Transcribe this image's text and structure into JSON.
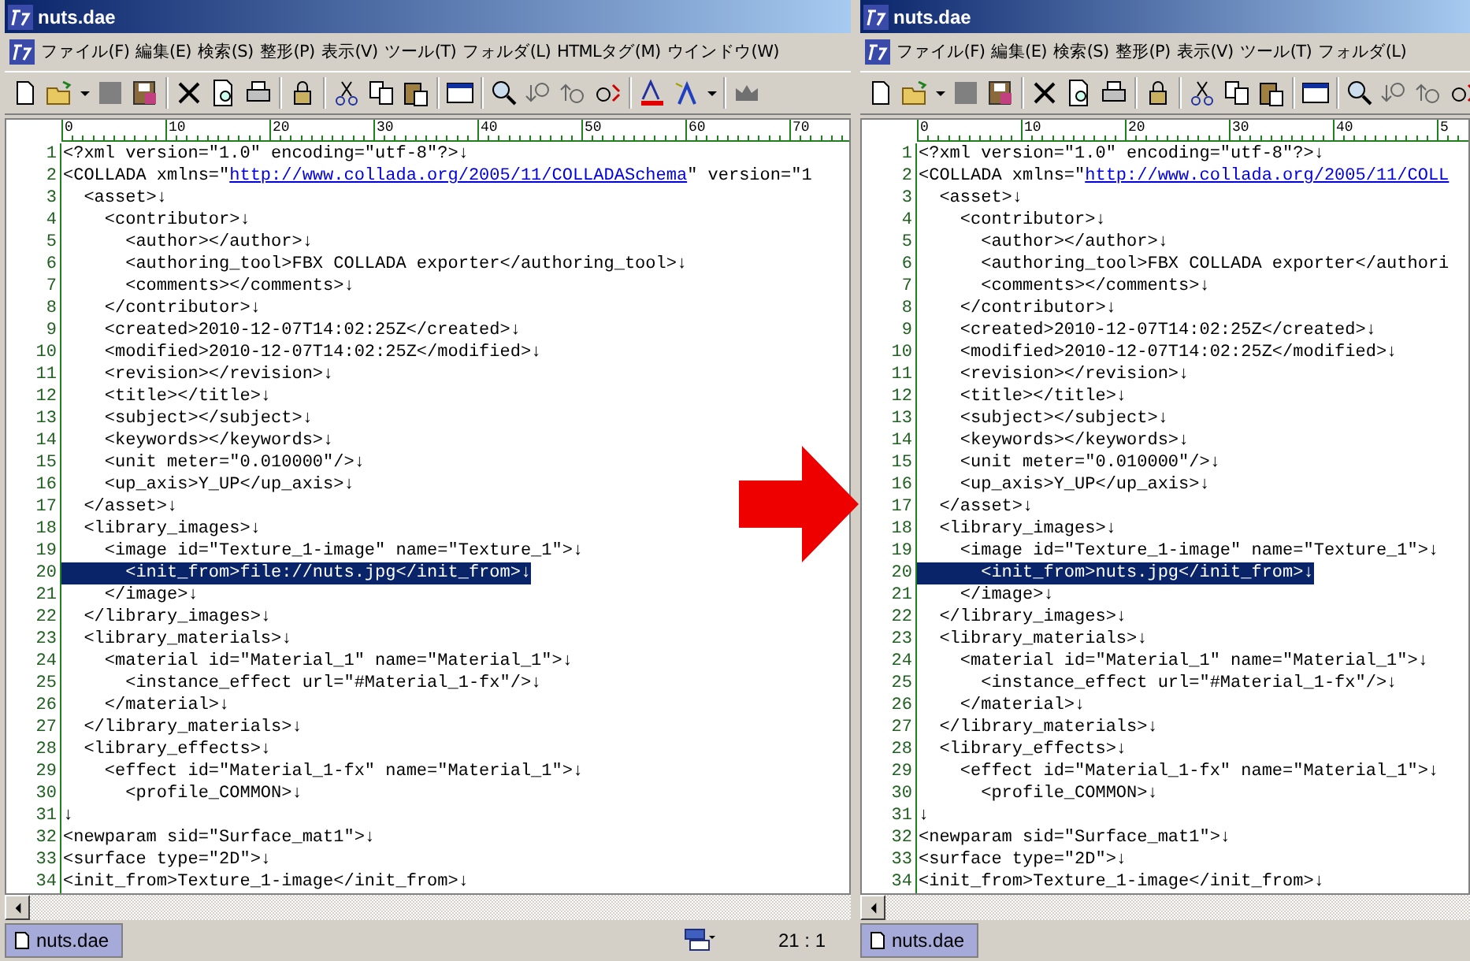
{
  "panes": [
    {
      "title": "nuts.dae",
      "menu": [
        "ファイル(F)",
        "編集(E)",
        "検索(S)",
        "整形(P)",
        "表示(V)",
        "ツール(T)",
        "フォルダ(L)",
        "HTMLタグ(M)",
        "ウインドウ(W)"
      ],
      "ruler": [
        "0",
        "10",
        "20",
        "30",
        "40",
        "50",
        "60",
        "70"
      ],
      "lines": [
        {
          "number": "1",
          "text": "<?xml version=\"1.0\" encoding=\"utf-8\"?>↓",
          "selected": false
        },
        {
          "number": "2",
          "text": "<COLLADA xmlns=\"",
          "link": "http://www.collada.org/2005/11/COLLADASchema",
          "after": "\" version=\"1",
          "selected": false
        },
        {
          "number": "3",
          "text": "  <asset>↓",
          "selected": false
        },
        {
          "number": "4",
          "text": "    <contributor>↓",
          "selected": false
        },
        {
          "number": "5",
          "text": "      <author></author>↓",
          "selected": false
        },
        {
          "number": "6",
          "text": "      <authoring_tool>FBX COLLADA exporter</authoring_tool>↓",
          "selected": false
        },
        {
          "number": "7",
          "text": "      <comments></comments>↓",
          "selected": false
        },
        {
          "number": "8",
          "text": "    </contributor>↓",
          "selected": false
        },
        {
          "number": "9",
          "text": "    <created>2010-12-07T14:02:25Z</created>↓",
          "selected": false
        },
        {
          "number": "10",
          "text": "    <modified>2010-12-07T14:02:25Z</modified>↓",
          "selected": false
        },
        {
          "number": "11",
          "text": "    <revision></revision>↓",
          "selected": false
        },
        {
          "number": "12",
          "text": "    <title></title>↓",
          "selected": false
        },
        {
          "number": "13",
          "text": "    <subject></subject>↓",
          "selected": false
        },
        {
          "number": "14",
          "text": "    <keywords></keywords>↓",
          "selected": false
        },
        {
          "number": "15",
          "text": "    <unit meter=\"0.010000\"/>↓",
          "selected": false
        },
        {
          "number": "16",
          "text": "    <up_axis>Y_UP</up_axis>↓",
          "selected": false
        },
        {
          "number": "17",
          "text": "  </asset>↓",
          "selected": false
        },
        {
          "number": "18",
          "text": "  <library_images>↓",
          "selected": false
        },
        {
          "number": "19",
          "text": "    <image id=\"Texture_1-image\" name=\"Texture_1\">↓",
          "selected": false
        },
        {
          "number": "20",
          "text": "      <init_from>file://nuts.jpg</init_from>↓",
          "selected": true
        },
        {
          "number": "21",
          "text": "    </image>↓",
          "selected": false
        },
        {
          "number": "22",
          "text": "  </library_images>↓",
          "selected": false
        },
        {
          "number": "23",
          "text": "  <library_materials>↓",
          "selected": false
        },
        {
          "number": "24",
          "text": "    <material id=\"Material_1\" name=\"Material_1\">↓",
          "selected": false
        },
        {
          "number": "25",
          "text": "      <instance_effect url=\"#Material_1-fx\"/>↓",
          "selected": false
        },
        {
          "number": "26",
          "text": "    </material>↓",
          "selected": false
        },
        {
          "number": "27",
          "text": "  </library_materials>↓",
          "selected": false
        },
        {
          "number": "28",
          "text": "  <library_effects>↓",
          "selected": false
        },
        {
          "number": "29",
          "text": "    <effect id=\"Material_1-fx\" name=\"Material_1\">↓",
          "selected": false
        },
        {
          "number": "30",
          "text": "      <profile_COMMON>↓",
          "selected": false
        },
        {
          "number": "31",
          "text": "↓",
          "selected": false
        },
        {
          "number": "32",
          "text": "<newparam sid=\"Surface_mat1\">↓",
          "selected": false
        },
        {
          "number": "33",
          "text": "<surface type=\"2D\">↓",
          "selected": false
        },
        {
          "number": "34",
          "text": "<init_from>Texture_1-image</init_from>↓",
          "selected": false
        }
      ],
      "status": {
        "tab": "nuts.dae",
        "position": "21 : 1"
      }
    },
    {
      "title": "nuts.dae",
      "menu": [
        "ファイル(F)",
        "編集(E)",
        "検索(S)",
        "整形(P)",
        "表示(V)",
        "ツール(T)",
        "フォルダ(L)"
      ],
      "ruler": [
        "0",
        "10",
        "20",
        "30",
        "40",
        "5"
      ],
      "lines": [
        {
          "number": "1",
          "text": "<?xml version=\"1.0\" encoding=\"utf-8\"?>↓",
          "selected": false
        },
        {
          "number": "2",
          "text": "<COLLADA xmlns=\"",
          "link": "http://www.collada.org/2005/11/COLL",
          "selected": false
        },
        {
          "number": "3",
          "text": "  <asset>↓",
          "selected": false
        },
        {
          "number": "4",
          "text": "    <contributor>↓",
          "selected": false
        },
        {
          "number": "5",
          "text": "      <author></author>↓",
          "selected": false
        },
        {
          "number": "6",
          "text": "      <authoring_tool>FBX COLLADA exporter</authori",
          "selected": false
        },
        {
          "number": "7",
          "text": "      <comments></comments>↓",
          "selected": false
        },
        {
          "number": "8",
          "text": "    </contributor>↓",
          "selected": false
        },
        {
          "number": "9",
          "text": "    <created>2010-12-07T14:02:25Z</created>↓",
          "selected": false
        },
        {
          "number": "10",
          "text": "    <modified>2010-12-07T14:02:25Z</modified>↓",
          "selected": false
        },
        {
          "number": "11",
          "text": "    <revision></revision>↓",
          "selected": false
        },
        {
          "number": "12",
          "text": "    <title></title>↓",
          "selected": false
        },
        {
          "number": "13",
          "text": "    <subject></subject>↓",
          "selected": false
        },
        {
          "number": "14",
          "text": "    <keywords></keywords>↓",
          "selected": false
        },
        {
          "number": "15",
          "text": "    <unit meter=\"0.010000\"/>↓",
          "selected": false
        },
        {
          "number": "16",
          "text": "    <up_axis>Y_UP</up_axis>↓",
          "selected": false
        },
        {
          "number": "17",
          "text": "  </asset>↓",
          "selected": false
        },
        {
          "number": "18",
          "text": "  <library_images>↓",
          "selected": false
        },
        {
          "number": "19",
          "text": "    <image id=\"Texture_1-image\" name=\"Texture_1\">↓",
          "selected": false
        },
        {
          "number": "20",
          "text": "      <init_from>nuts.jpg</init_from>↓",
          "selected": true
        },
        {
          "number": "21",
          "text": "    </image>↓",
          "selected": false
        },
        {
          "number": "22",
          "text": "  </library_images>↓",
          "selected": false
        },
        {
          "number": "23",
          "text": "  <library_materials>↓",
          "selected": false
        },
        {
          "number": "24",
          "text": "    <material id=\"Material_1\" name=\"Material_1\">↓",
          "selected": false
        },
        {
          "number": "25",
          "text": "      <instance_effect url=\"#Material_1-fx\"/>↓",
          "selected": false
        },
        {
          "number": "26",
          "text": "    </material>↓",
          "selected": false
        },
        {
          "number": "27",
          "text": "  </library_materials>↓",
          "selected": false
        },
        {
          "number": "28",
          "text": "  <library_effects>↓",
          "selected": false
        },
        {
          "number": "29",
          "text": "    <effect id=\"Material_1-fx\" name=\"Material_1\">↓",
          "selected": false
        },
        {
          "number": "30",
          "text": "      <profile_COMMON>↓",
          "selected": false
        },
        {
          "number": "31",
          "text": "↓",
          "selected": false
        },
        {
          "number": "32",
          "text": "<newparam sid=\"Surface_mat1\">↓",
          "selected": false
        },
        {
          "number": "33",
          "text": "<surface type=\"2D\">↓",
          "selected": false
        },
        {
          "number": "34",
          "text": "<init_from>Texture_1-image</init_from>↓",
          "selected": false
        }
      ],
      "status": {
        "tab": "nuts.dae"
      }
    }
  ]
}
